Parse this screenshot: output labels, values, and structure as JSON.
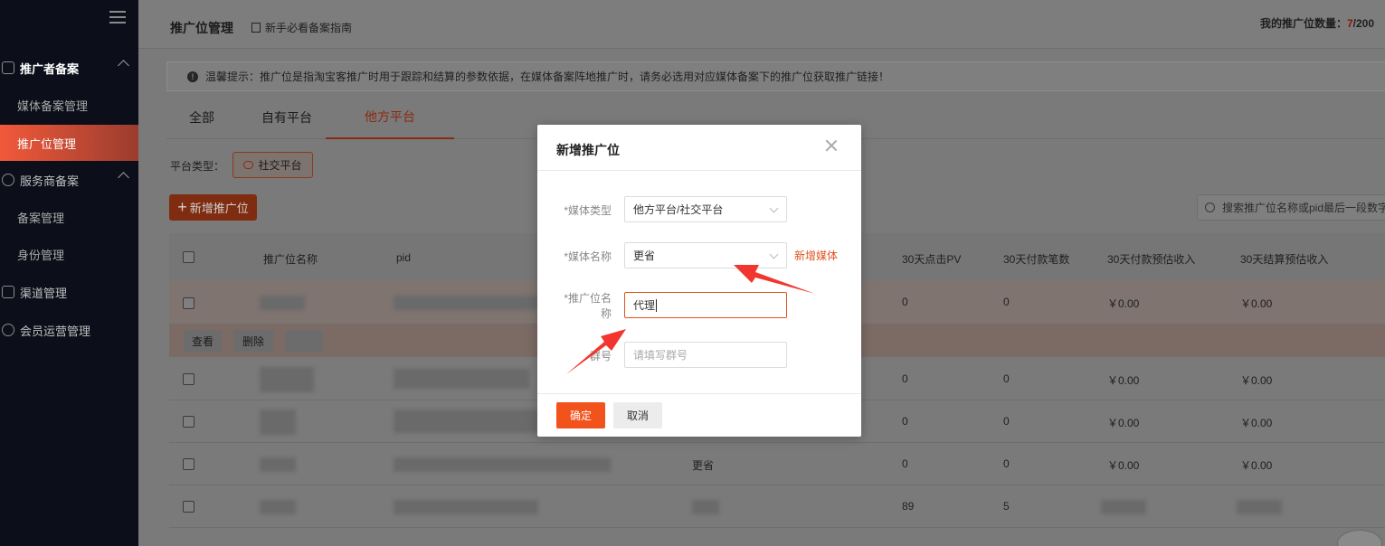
{
  "sidebar": {
    "groups": [
      {
        "label": "推广者备案",
        "items": [
          {
            "label": "媒体备案管理",
            "active": false
          },
          {
            "label": "推广位管理",
            "active": true
          }
        ]
      },
      {
        "label": "服务商备案",
        "items": [
          {
            "label": "备案管理",
            "active": false
          },
          {
            "label": "身份管理",
            "active": false
          }
        ]
      }
    ],
    "extra_items": [
      {
        "label": "渠道管理"
      },
      {
        "label": "会员运营管理"
      }
    ]
  },
  "header": {
    "title": "推广位管理",
    "guide_link": "新手必看备案指南",
    "count_label": "我的推广位数量：",
    "count_used": "7",
    "count_total": "/200"
  },
  "notice": {
    "text": "温馨提示：推广位是指淘宝客推广时用于跟踪和结算的参数依据，在媒体备案阵地推广时，请务必选用对应媒体备案下的推广位获取推广链接！"
  },
  "tabs": [
    {
      "label": "全部",
      "active": false
    },
    {
      "label": "自有平台",
      "active": false
    },
    {
      "label": "他方平台",
      "active": true
    }
  ],
  "filter": {
    "platform_type_label": "平台类型：",
    "platform_type_value": "社交平台"
  },
  "toolbar": {
    "add_label": "新增推广位",
    "search_placeholder": "搜索推广位名称或pid最后一段数字"
  },
  "table": {
    "columns": [
      "推广位名称",
      "pid",
      "30天点击PV",
      "30天付款笔数",
      "30天付款预估收入",
      "30天结算预估收入"
    ],
    "rows": [
      {
        "pv": "0",
        "orders": "0",
        "income": "￥0.00",
        "settle": "￥0.00"
      },
      {
        "pv": "0",
        "orders": "0",
        "income": "￥0.00",
        "settle": "￥0.00"
      },
      {
        "pv": "0",
        "orders": "0",
        "income": "￥0.00",
        "settle": "￥0.00"
      },
      {
        "pv": "0",
        "orders": "0",
        "income": "￥0.00",
        "settle": "￥0.00",
        "media": "更省"
      },
      {
        "pv": "89",
        "orders": "5",
        "income": "",
        "settle": ""
      }
    ],
    "row_actions": {
      "view": "查看",
      "delete": "删除"
    }
  },
  "modal": {
    "title": "新增推广位",
    "fields": {
      "media_type": {
        "label": "*媒体类型",
        "value": "他方平台/社交平台"
      },
      "media_name": {
        "label": "*媒体名称",
        "value": "更省"
      },
      "slot_name": {
        "label_line1": "*推广位名",
        "label_line2": "称",
        "value": "代理"
      },
      "group_no": {
        "label": "群号",
        "placeholder": "请填写群号"
      }
    },
    "new_media_link": "新增媒体",
    "ok_label": "确定",
    "cancel_label": "取消"
  },
  "colors": {
    "accent": "#f2521b",
    "sidebar_bg": "#0c0f1a",
    "active_gradient_start": "#f1593a"
  }
}
